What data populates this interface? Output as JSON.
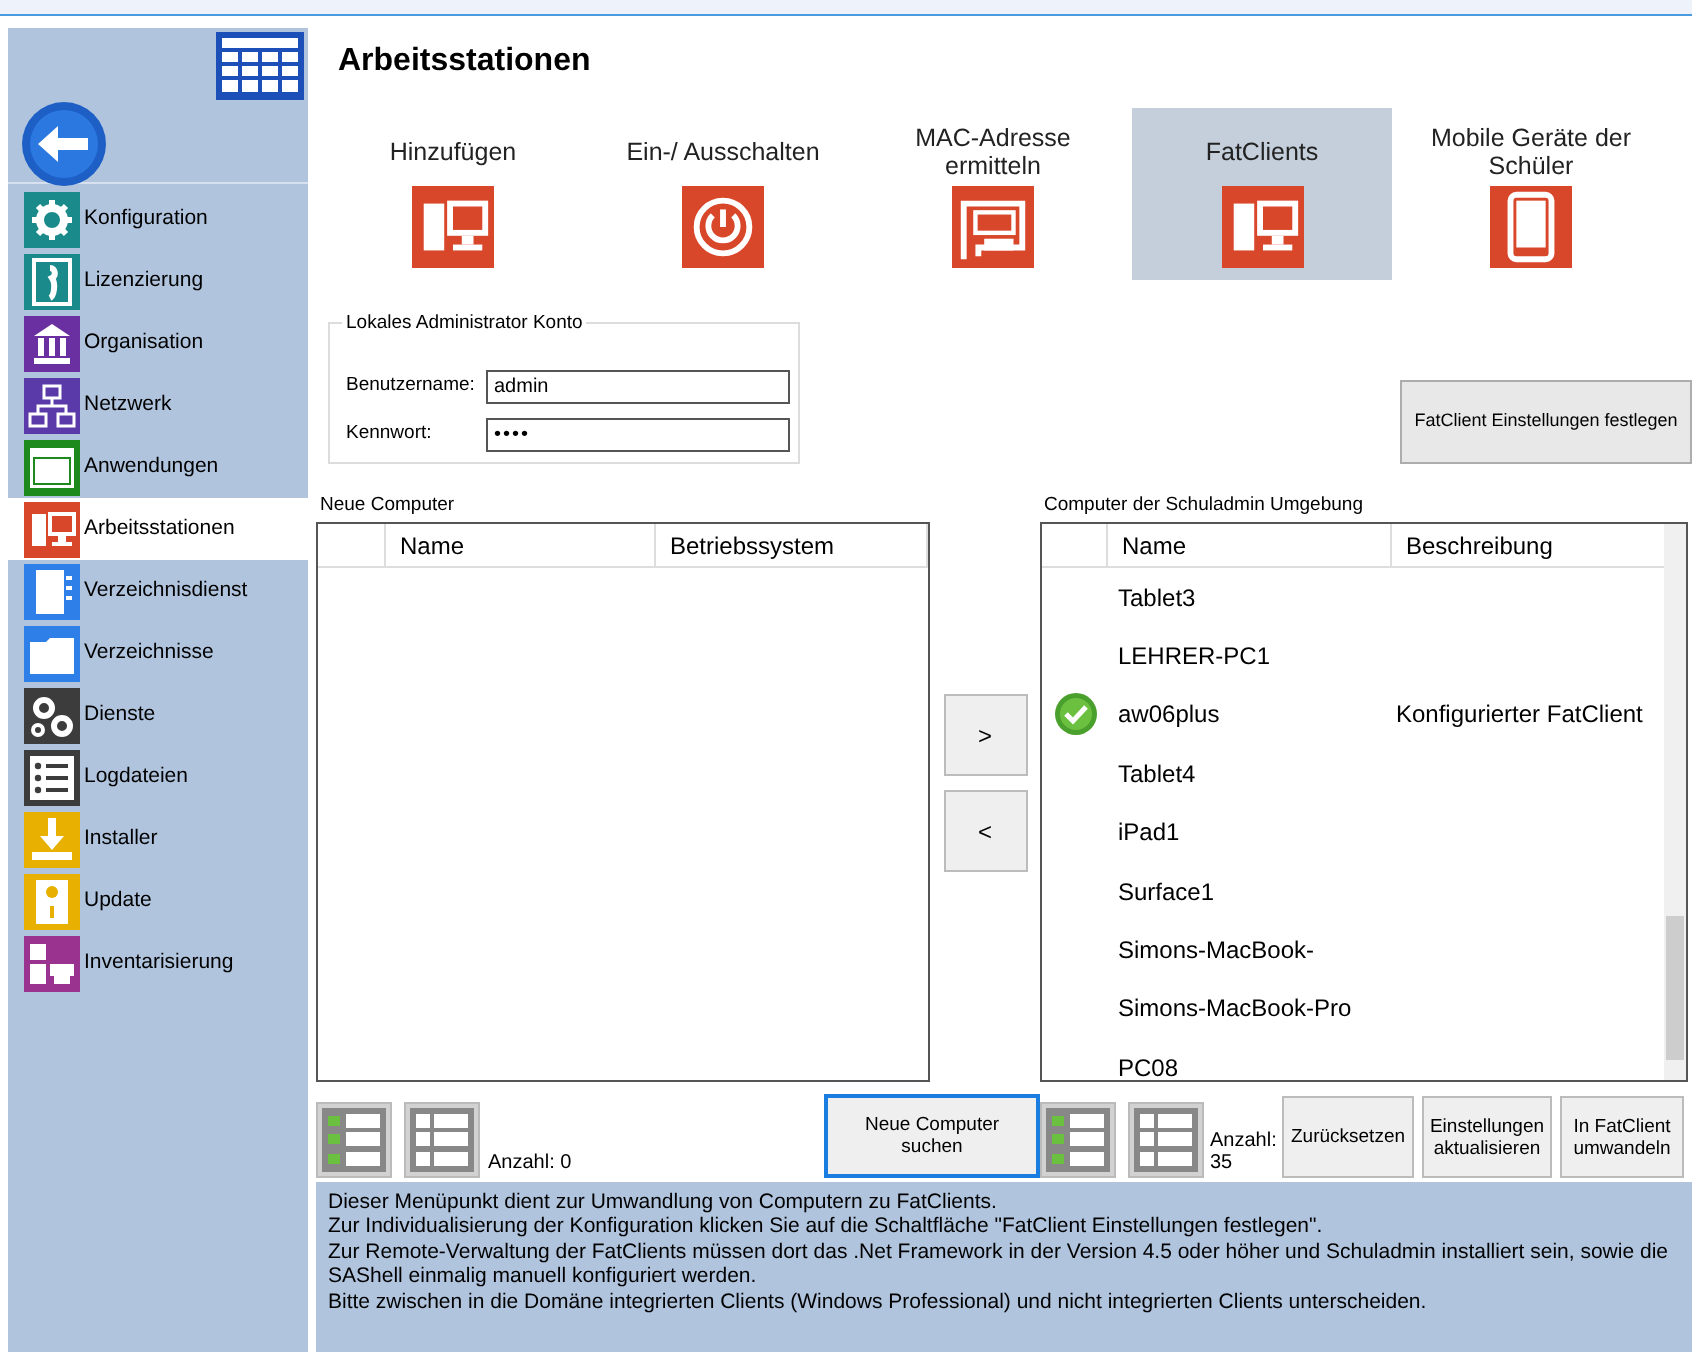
{
  "sidebar": {
    "items": [
      {
        "label": "Konfiguration",
        "kind": "gear",
        "color": "#1a8a8a",
        "selected": false
      },
      {
        "label": "Lizenzierung",
        "kind": "license",
        "color": "#1a8a8a",
        "selected": false
      },
      {
        "label": "Organisation",
        "kind": "building",
        "color": "#6a2fa0",
        "selected": false
      },
      {
        "label": "Netzwerk",
        "kind": "network",
        "color": "#5a3aa8",
        "selected": false
      },
      {
        "label": "Anwendungen",
        "kind": "window",
        "color": "#1e8a1e",
        "selected": false
      },
      {
        "label": "Arbeitsstationen",
        "kind": "computer",
        "color": "#d9472b",
        "selected": true
      },
      {
        "label": "Verzeichnisdienst",
        "kind": "book",
        "color": "#2f7fe8",
        "selected": false
      },
      {
        "label": "Verzeichnisse",
        "kind": "folder",
        "color": "#2f7fe8",
        "selected": false
      },
      {
        "label": "Dienste",
        "kind": "gears",
        "color": "#3c3c3c",
        "selected": false
      },
      {
        "label": "Logdateien",
        "kind": "list",
        "color": "#3c3c3c",
        "selected": false
      },
      {
        "label": "Installer",
        "kind": "download",
        "color": "#e8b000",
        "selected": false
      },
      {
        "label": "Update",
        "kind": "update",
        "color": "#e8b000",
        "selected": false
      },
      {
        "label": "Inventarisierung",
        "kind": "inventory",
        "color": "#9a3390",
        "selected": false
      }
    ]
  },
  "title": "Arbeitsstationen",
  "tiles": [
    {
      "label": "Hinzufügen",
      "kind": "computer",
      "selected": false
    },
    {
      "label": "Ein-/ Ausschalten",
      "kind": "power",
      "selected": false
    },
    {
      "label": "MAC-Adresse ermitteln",
      "kind": "card",
      "selected": false
    },
    {
      "label": "FatClients",
      "kind": "computer",
      "selected": true
    },
    {
      "label": "Mobile Geräte der Schüler",
      "kind": "tablet",
      "selected": false
    }
  ],
  "admin_account": {
    "legend": "Lokales Administrator Konto",
    "fields": [
      {
        "label": "Benutzername:",
        "value": "admin",
        "kind": "text"
      },
      {
        "label": "Kennwort:",
        "value": "••••",
        "kind": "password"
      }
    ]
  },
  "settings_button": "FatClient Einstellungen festlegen",
  "new_computers": {
    "label": "Neue Computer",
    "columns": [
      "Name",
      "Betriebssystem"
    ],
    "count": "Anzahl: 0",
    "search_button": "Neue Computer suchen"
  },
  "move_buttons": [
    ">",
    "<"
  ],
  "environment": {
    "label": "Computer der Schuladmin Umgebung",
    "columns": [
      "Name",
      "Beschreibung"
    ],
    "rows": [
      {
        "name": "Tablet3",
        "configured": false
      },
      {
        "name": "LEHRER-PC1",
        "configured": false
      },
      {
        "name": "aw06plus",
        "description": "Konfigurierter FatClient",
        "configured": true
      },
      {
        "name": "Tablet4",
        "configured": false
      },
      {
        "name": "iPad1",
        "configured": false
      },
      {
        "name": "Surface1",
        "configured": false
      },
      {
        "name": "Simons-MacBook-",
        "configured": false
      },
      {
        "name": "Simons-MacBook-Pro",
        "configured": false
      },
      {
        "name": "PC08",
        "configured": false
      }
    ],
    "count": "Anzahl: 35",
    "buttons": [
      "Zurücksetzen",
      "Einstellungen aktualisieren",
      "In FatClient umwandeln"
    ]
  },
  "description": [
    "Dieser Menüpunkt dient zur Umwandlung von Computern zu FatClients.",
    "Zur Individualisierung der Konfiguration klicken Sie auf die Schaltfläche \"FatClient Einstellungen festlegen\".",
    "Zur Remote-Verwaltung der FatClients müssen dort das .Net Framework in der Version 4.5 oder höher und Schuladmin installiert sein, sowie die SAShell einmalig manuell konfiguriert werden.",
    "Bitte zwischen in die Domäne integrierten Clients (Windows Professional) und nicht integrierten Clients unterscheiden."
  ]
}
